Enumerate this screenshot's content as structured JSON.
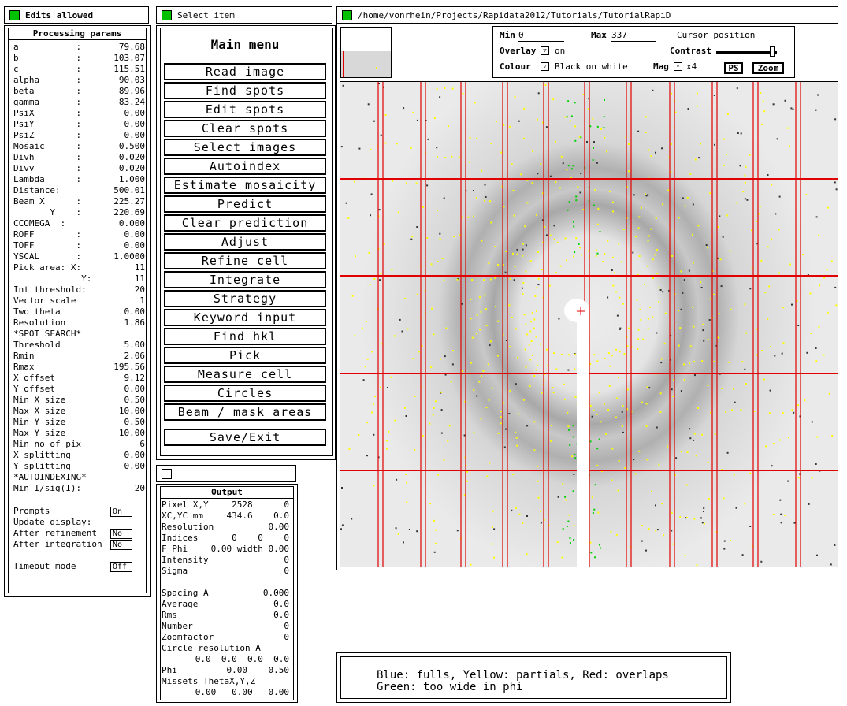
{
  "params_panel": {
    "title": "Edits allowed",
    "heading": "Processing params",
    "rows": [
      {
        "label": "a           :",
        "value": "79.68"
      },
      {
        "label": "b           :",
        "value": "103.07"
      },
      {
        "label": "c           :",
        "value": "115.51"
      },
      {
        "label": "alpha       :",
        "value": "90.03"
      },
      {
        "label": "beta        :",
        "value": "89.96"
      },
      {
        "label": "gamma       :",
        "value": "83.24"
      },
      {
        "label": "PsiX        :",
        "value": "0.00"
      },
      {
        "label": "PsiY        :",
        "value": "0.00"
      },
      {
        "label": "PsiZ        :",
        "value": "0.00"
      },
      {
        "label": "Mosaic      :",
        "value": "0.500"
      },
      {
        "label": "Divh        :",
        "value": "0.020"
      },
      {
        "label": "Divv        :",
        "value": "0.020"
      },
      {
        "label": "Lambda      :",
        "value": "1.000"
      },
      {
        "label": "Distance:",
        "value": "500.01"
      },
      {
        "label": "Beam X      :",
        "value": "225.27"
      },
      {
        "label": "       Y    :",
        "value": "220.69"
      },
      {
        "label": "CCOMEGA  :",
        "value": "0.000"
      },
      {
        "label": "ROFF        :",
        "value": "0.00"
      },
      {
        "label": "TOFF        :",
        "value": "0.00"
      },
      {
        "label": "YSCAL       :",
        "value": "1.0000"
      },
      {
        "label": "Pick area: X:",
        "value": "11"
      },
      {
        "label": "             Y:",
        "value": "11"
      },
      {
        "label": "Int threshold:",
        "value": "20"
      },
      {
        "label": "Vector scale",
        "value": "1"
      },
      {
        "label": "Two theta",
        "value": "0.00"
      },
      {
        "label": "Resolution",
        "value": "1.86"
      },
      {
        "label": "*SPOT SEARCH*",
        "value": ""
      },
      {
        "label": "Threshold",
        "value": "5.00"
      },
      {
        "label": "Rmin",
        "value": "2.06"
      },
      {
        "label": "Rmax",
        "value": "195.56"
      },
      {
        "label": "X offset",
        "value": "9.12"
      },
      {
        "label": "Y offset",
        "value": "0.00"
      },
      {
        "label": "Min X size",
        "value": "0.50"
      },
      {
        "label": "Max X size",
        "value": "10.00"
      },
      {
        "label": "Min Y size",
        "value": "0.50"
      },
      {
        "label": "Max Y size",
        "value": "10.00"
      },
      {
        "label": "Min no of pix",
        "value": "6"
      },
      {
        "label": "X splitting",
        "value": "0.00"
      },
      {
        "label": "Y splitting",
        "value": "0.00"
      },
      {
        "label": "*AUTOINDEXING*",
        "value": ""
      },
      {
        "label": "Min I/sig(I):",
        "value": "20"
      }
    ],
    "prompts_label": "Prompts",
    "prompts_value": "On",
    "update_label": "Update display:",
    "after_refinement_label": "After refinement",
    "after_refinement_value": "No",
    "after_integration_label": "After integration",
    "after_integration_value": "No",
    "timeout_label": "Timeout mode",
    "timeout_value": "Off"
  },
  "menu_panel": {
    "title": "Select item",
    "heading": "Main menu",
    "items": [
      "Read image",
      "Find spots",
      "Edit spots",
      "Clear spots",
      "Select images",
      "Autoindex",
      "Estimate mosaicity",
      "Predict",
      "Clear prediction",
      "Adjust",
      "Refine cell",
      "Integrate",
      "Strategy",
      "Keyword input",
      "Find hkl",
      "Pick",
      "Measure cell",
      "Circles",
      "Beam / mask areas"
    ],
    "save_exit": "Save/Exit"
  },
  "output_panel": {
    "heading": "Output",
    "rows": [
      {
        "label": "Pixel X,Y",
        "value": "2528      0"
      },
      {
        "label": "XC,YC mm",
        "value": "434.6    0.0"
      },
      {
        "label": "Resolution",
        "value": "0.00"
      },
      {
        "label": "Indices",
        "value": "0    0    0"
      },
      {
        "label": "F Phi",
        "value": "0.00 width 0.00"
      },
      {
        "label": "Intensity",
        "value": "0"
      },
      {
        "label": "Sigma",
        "value": "0"
      },
      {
        "label": "",
        "value": ""
      },
      {
        "label": "Spacing  A",
        "value": "0.000"
      },
      {
        "label": "Average",
        "value": "0.0"
      },
      {
        "label": "Rms",
        "value": "0.0"
      },
      {
        "label": "Number",
        "value": "0"
      },
      {
        "label": "Zoomfactor",
        "value": "0"
      },
      {
        "label": "Circle resolution A",
        "value": ""
      },
      {
        "label": "",
        "value": "0.0  0.0  0.0  0.0"
      },
      {
        "label": "Phi",
        "value": "0.00    0.50"
      },
      {
        "label": "Missets ThetaX,Y,Z",
        "value": ""
      },
      {
        "label": "",
        "value": "0.00   0.00   0.00"
      }
    ]
  },
  "image_panel": {
    "path": "/home/vonrhein/Projects/Rapidata2012/Tutorials/TutorialRapiD",
    "min_label": "Min",
    "min_value": "0",
    "max_label": "Max",
    "max_value": "337",
    "cursor_label": "Cursor position",
    "overlay_label": "Overlay",
    "overlay_value": "on",
    "contrast_label": "Contrast",
    "contrast_level": 0.92,
    "colour_label": "Colour",
    "colour_value": "Black on white",
    "mag_label": "Mag",
    "mag_value": "x4",
    "ps_button": "PS",
    "zoom_button": "Zoom"
  },
  "legend": {
    "line1": "Blue: fulls, Yellow: partials, Red: overlaps",
    "line2": "Green: too wide in phi"
  },
  "colors": {
    "panel_green": "#00c000",
    "grid_red": "#e00000",
    "partial_yellow": "#ffff00",
    "too_wide_green": "#00d000"
  }
}
